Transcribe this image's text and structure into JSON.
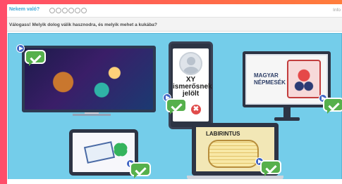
{
  "header": {
    "app_title": "Nekem való?",
    "progress_dots": 6,
    "info_label": "Info"
  },
  "question": {
    "text": "Válogass! Melyik dolog válik hasznodra, és melyik mehet a kukába?"
  },
  "cards": {
    "tv": {
      "label": ""
    },
    "phone": {
      "lines": [
        "XY",
        "ismerősnek",
        "jelölt"
      ],
      "reject_icon": "✖"
    },
    "monitor": {
      "lines": [
        "MAGYAR",
        "NÉPMESÉK"
      ]
    },
    "laptop": {
      "label": "LABIRINTUS"
    }
  },
  "colors": {
    "accent": "#3ea7d8",
    "board_bg": "#74cdea",
    "check_green": "#56b04c",
    "select_blue": "#3f63c3",
    "reject_red": "#e04b4b"
  }
}
